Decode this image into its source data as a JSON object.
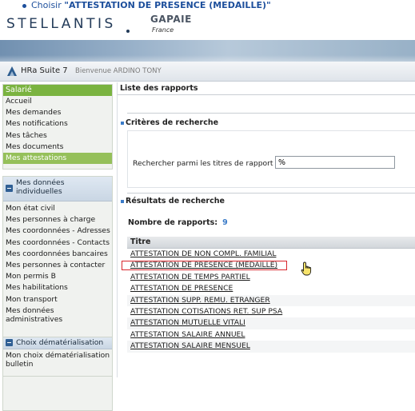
{
  "instruction": {
    "prefix": "Choisir ",
    "quote_open": "\"",
    "highlight": "ATTESTATION DE PRESENCE (MEDAILLE)",
    "quote_close": "\""
  },
  "brand": {
    "company": "STELLANTIS",
    "product": "GAPAIE",
    "country": "France",
    "separator": "•"
  },
  "appbar": {
    "title": "HRa Suite 7",
    "welcome": "Bienvenue ARDINO TONY"
  },
  "sidebar": {
    "salarie": {
      "header": "Salarié",
      "items": [
        "Accueil",
        "Mes demandes",
        "Mes notifications",
        "Mes tâches",
        "Mes documents",
        "Mes attestations"
      ],
      "active_index": 5
    },
    "donnees": {
      "header": "Mes données individuelles",
      "items": [
        "Mon état civil",
        "Mes personnes à charge",
        "Mes coordonnées - Adresses",
        "Mes coordonnées - Contacts",
        "Mes coordonnées bancaires",
        "Mes personnes à contacter",
        "Mon permis B",
        "Mes habilitations",
        "Mon transport",
        "Mes données administratives"
      ]
    },
    "dematerialisation": {
      "header": "Choix dématérialisation",
      "items": [
        "Mon choix dématérialisation bulletin"
      ]
    }
  },
  "main": {
    "title": "Liste des rapports",
    "criteria": {
      "heading": "Critères de recherche",
      "search_label": "Rechercher parmi les titres de rapport",
      "search_value": "%"
    },
    "results": {
      "heading": "Résultats de recherche",
      "count_label": "Nombre de rapports:",
      "count_value": "9",
      "column": "Titre",
      "rows": [
        "ATTESTATION DE NON COMPL. FAMILIAL",
        "ATTESTATION DE PRESENCE (MEDAILLE)",
        "ATTESTATION DE TEMPS PARTIEL",
        "ATTESTATION DE PRESENCE",
        "ATTESTATION SUPP. REMU. ETRANGER",
        "ATTESTATION COTISATIONS RET. SUP PSA",
        "ATTESTATION MUTUELLE VITALI",
        "ATTESTATION SALAIRE ANNUEL",
        "ATTESTATION SALAIRE MENSUEL"
      ],
      "highlighted_index": 1
    }
  },
  "colors": {
    "accent_green": "#7ab340",
    "active_green": "#95c05a",
    "highlight_red": "#d8262d",
    "link_blue": "#3a7bc8"
  }
}
